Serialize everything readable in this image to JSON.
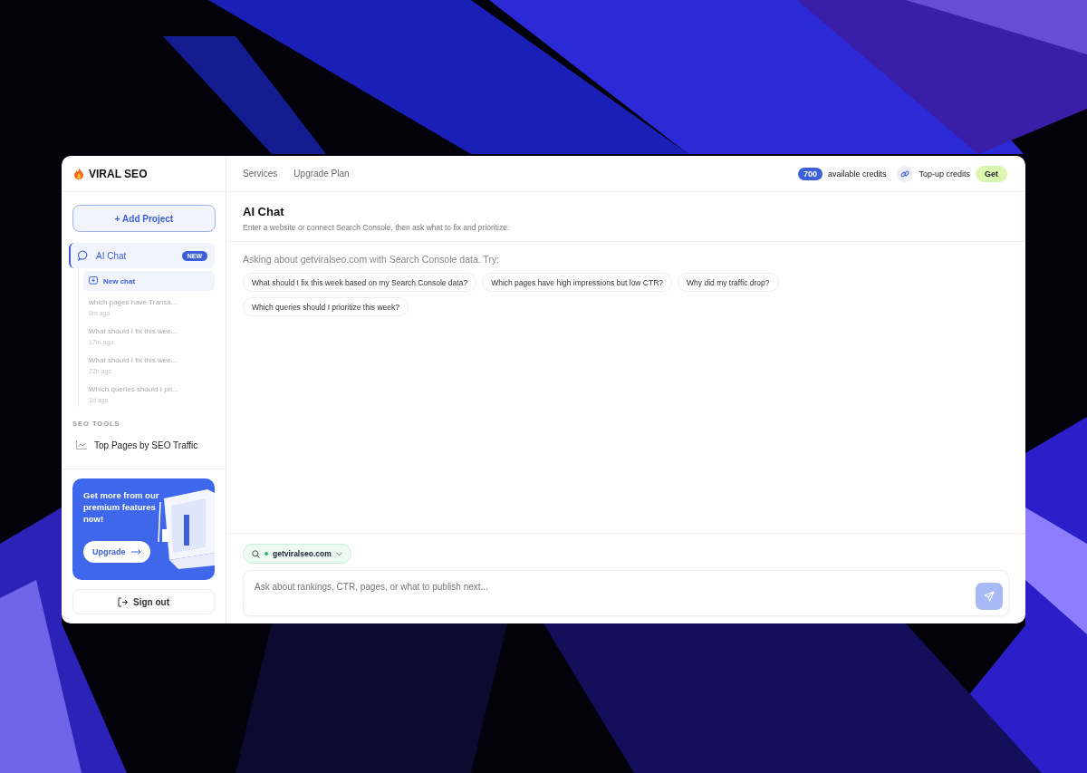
{
  "header": {
    "logo": "VIRAL SEO",
    "nav": [
      {
        "label": "Services"
      },
      {
        "label": "Upgrade Plan"
      }
    ],
    "credits_count": "700",
    "credits_label": "available credits",
    "topup_label": "Top-up credits",
    "get_button": "Get"
  },
  "sidebar": {
    "add_project": "+ Add Project",
    "items": [
      {
        "label": "AI Chat",
        "badge": "NEW",
        "selected": true,
        "new_chat": "New chat",
        "history": [
          {
            "title": "which pages have Transa...",
            "time": "9m ago",
            "selected": false
          },
          {
            "title": "What should I fix this wee...",
            "time": "17m ago",
            "selected": false
          },
          {
            "title": "What should I fix this wee...",
            "time": "22h ago",
            "selected": false
          },
          {
            "title": "Which queries should I pri...",
            "time": "1d ago",
            "selected": false
          }
        ]
      }
    ],
    "section_label": "SEO TOOLS",
    "tools": [
      {
        "label": "Top Pages by SEO Traffic",
        "selected": false
      }
    ],
    "promo": {
      "text": "Get more from our premium features now!",
      "button": "Upgrade"
    },
    "sign_out": "Sign out"
  },
  "main": {
    "title": "AI Chat",
    "subtitle": "Enter a website or connect Search Console, then ask what to fix and prioritize.",
    "prompt_intro": "Asking about getviralseo.com with Search Console data. Try:",
    "suggestions": [
      "What should I fix this week based on my Search Console data?",
      "Which pages have high impressions but low CTR?",
      "Why did my traffic drop?",
      "Which queries should I prioritize this week?"
    ],
    "domain": {
      "label": "getviralseo.com",
      "connected": true
    },
    "input": {
      "placeholder": "Ask about rankings, CTR, pages, or what to publish next..."
    }
  }
}
